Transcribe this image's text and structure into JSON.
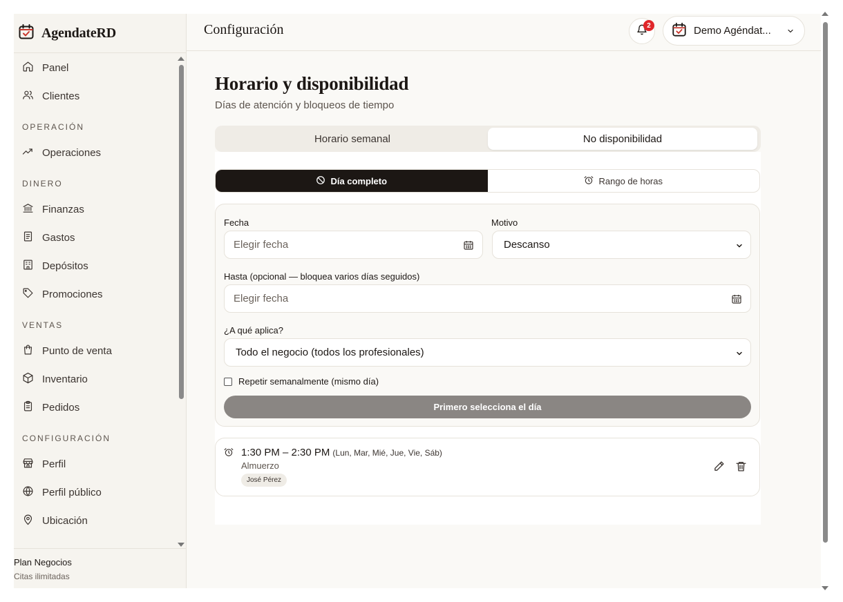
{
  "brand": {
    "name": "AgendateRD"
  },
  "sidebar": {
    "items": [
      {
        "type": "item",
        "label": "Panel",
        "icon": "home-icon"
      },
      {
        "type": "item",
        "label": "Clientes",
        "icon": "users-icon"
      },
      {
        "type": "section",
        "label": "OPERACIÓN"
      },
      {
        "type": "item",
        "label": "Operaciones",
        "icon": "trend-icon"
      },
      {
        "type": "section",
        "label": "DINERO"
      },
      {
        "type": "item",
        "label": "Finanzas",
        "icon": "bank-icon"
      },
      {
        "type": "item",
        "label": "Gastos",
        "icon": "receipt-icon"
      },
      {
        "type": "item",
        "label": "Depósitos",
        "icon": "building-icon"
      },
      {
        "type": "item",
        "label": "Promociones",
        "icon": "tag-icon"
      },
      {
        "type": "section",
        "label": "VENTAS"
      },
      {
        "type": "item",
        "label": "Punto de venta",
        "icon": "bag-icon"
      },
      {
        "type": "item",
        "label": "Inventario",
        "icon": "box-icon"
      },
      {
        "type": "item",
        "label": "Pedidos",
        "icon": "clipboard-icon"
      },
      {
        "type": "section",
        "label": "CONFIGURACIÓN"
      },
      {
        "type": "item",
        "label": "Perfil",
        "icon": "store-icon"
      },
      {
        "type": "item",
        "label": "Perfil público",
        "icon": "globe-icon"
      },
      {
        "type": "item",
        "label": "Ubicación",
        "icon": "pin-icon"
      }
    ],
    "plan": {
      "title": "Plan Negocios",
      "subtitle": "Citas ilimitadas"
    }
  },
  "header": {
    "title": "Configuración",
    "notifications_count": "2",
    "account_name": "Demo Agéndat..."
  },
  "page": {
    "title": "Horario y disponibilidad",
    "subtitle": "Días de atención y bloqueos de tiempo",
    "tabs": [
      {
        "label": "Horario semanal",
        "active": false
      },
      {
        "label": "No disponibilidad",
        "active": true
      }
    ]
  },
  "mode": {
    "full_day": "Día completo",
    "time_range": "Rango de horas",
    "active": "full_day"
  },
  "form": {
    "date_label": "Fecha",
    "date_placeholder": "Elegir fecha",
    "reason_label": "Motivo",
    "reason_value": "Descanso",
    "until_label": "Hasta (opcional — bloquea varios días seguidos)",
    "until_placeholder": "Elegir fecha",
    "applies_label": "¿A qué aplica?",
    "applies_value": "Todo el negocio (todos los profesionales)",
    "repeat_label": "Repetir semanalmente (mismo día)",
    "submit_label": "Primero selecciona el día"
  },
  "blocks": [
    {
      "time": "1:30 PM – 2:30 PM",
      "days": "(Lun, Mar, Mié, Jue, Vie, Sáb)",
      "reason": "Almuerzo",
      "staff": "José Pérez"
    }
  ],
  "colors": {
    "dark": "#1c1714",
    "background": "#faf9f6",
    "sidebar": "#f6f4ef",
    "badge": "#e0262a",
    "disabled_button": "#8a8683",
    "brand_red": "#c8362c"
  }
}
